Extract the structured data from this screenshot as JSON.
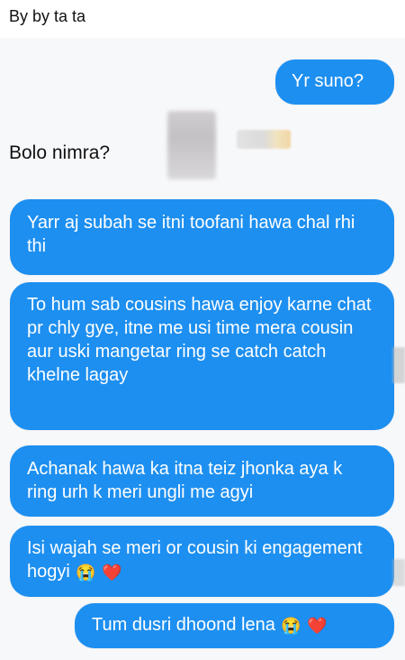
{
  "caption": "By by ta ta",
  "messages": {
    "outgoing_1": "Yr suno?",
    "incoming_1": "Bolo nimra?",
    "outgoing_2": "Yarr aj subah se itni toofani hawa chal rhi thi",
    "outgoing_3": "To hum sab cousins hawa enjoy karne chat pr chly gye, itne me usi time mera cousin aur uski mangetar ring se catch catch khelne lagay",
    "outgoing_4": "Achanak hawa ka itna teiz jhonka aya k ring urh k meri ungli me agyi",
    "outgoing_5": "Isi wajah se meri or cousin ki engagement hogyi",
    "outgoing_6": "Tum dusri dhoond lena"
  },
  "emojis": {
    "crying_1": "😭",
    "heart_1": "❤️",
    "crying_2": "😭",
    "heart_2": "❤️"
  },
  "colors": {
    "bubble": "#1d8ff0",
    "caption_text": "#111111",
    "background": "#f7f8fa"
  }
}
